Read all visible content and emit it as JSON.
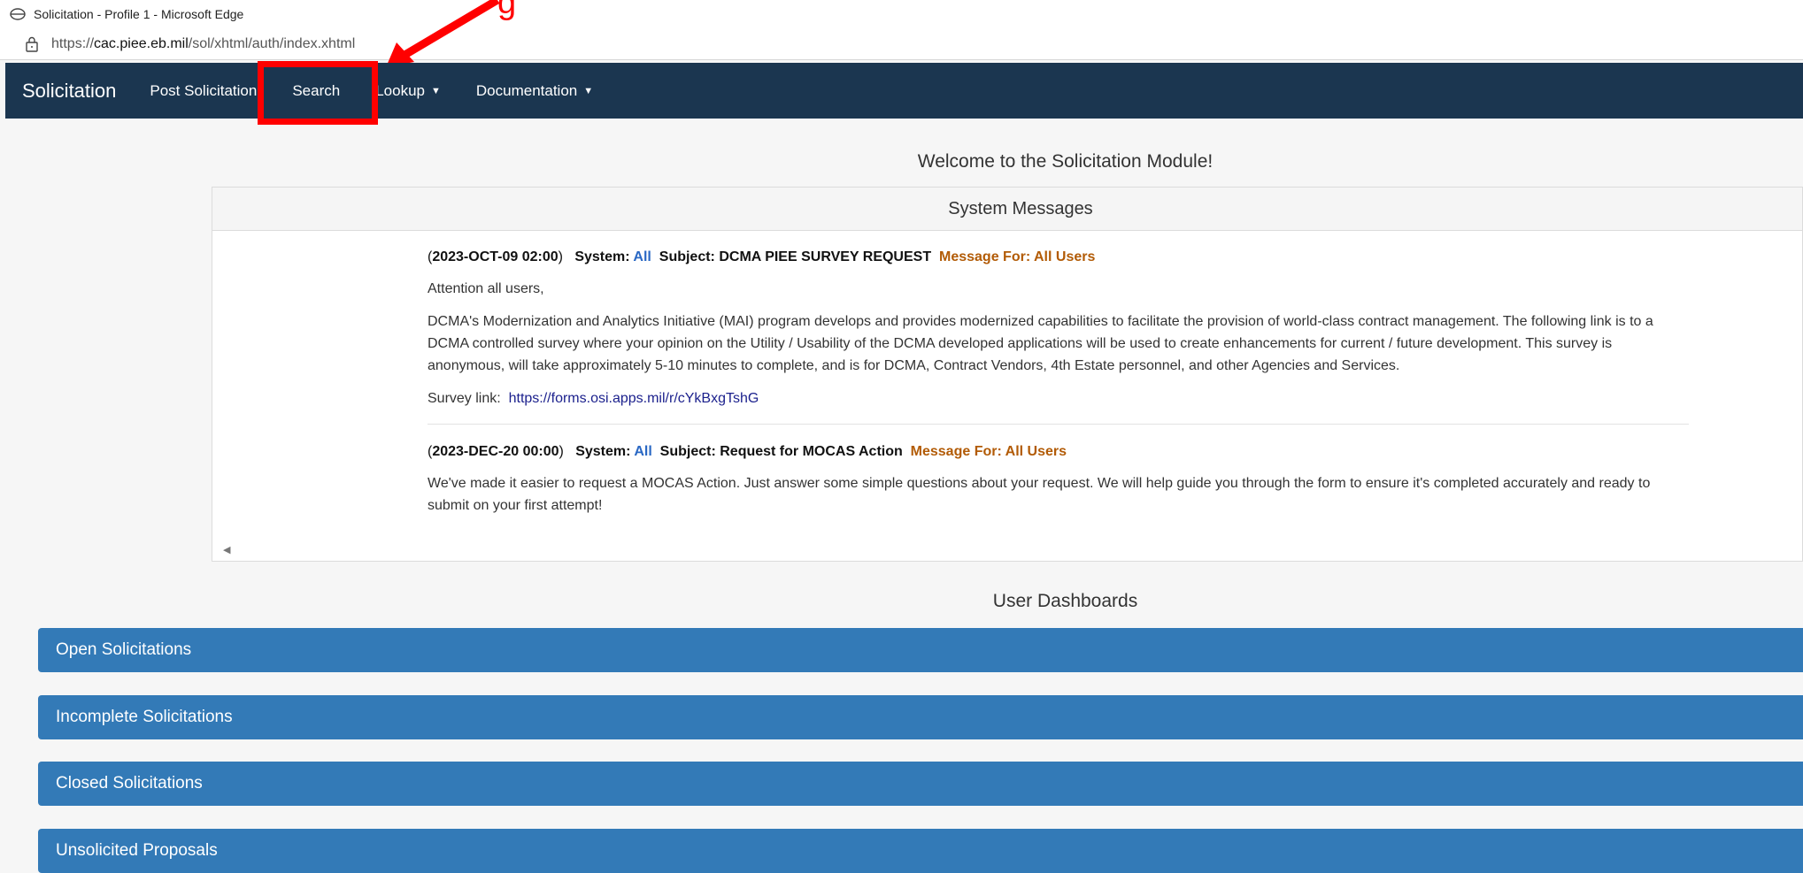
{
  "browser": {
    "window_title": "Solicitation - Profile 1 - Microsoft Edge",
    "url_prefix": "https://",
    "url_host": "cac.piee.eb.mil",
    "url_path": "/sol/xhtml/auth/index.xhtml"
  },
  "navbar": {
    "brand": "Solicitation",
    "items": [
      {
        "label": "Post Solicitation"
      },
      {
        "label": "Search"
      },
      {
        "label": "Lookup"
      },
      {
        "label": "Documentation"
      }
    ]
  },
  "welcome": "Welcome to the Solicitation Module!",
  "system_messages": {
    "header": "System Messages",
    "messages": [
      {
        "date": "2023-OCT-09 02:00",
        "system_label": "System:",
        "system_value": "All",
        "subject_label": "Subject:",
        "subject": "DCMA PIEE SURVEY REQUEST",
        "message_for": "Message For: All Users",
        "paragraphs": [
          "Attention all users,",
          "DCMA's Modernization and Analytics Initiative (MAI) program develops and provides modernized capabilities to facilitate the provision of world-class contract management.  The following link is to a DCMA controlled survey where your opinion on the Utility / Usability of the DCMA developed applications will be used to create enhancements for current / future development. This survey is anonymous, will take approximately 5-10 minutes to complete, and is for DCMA, Contract Vendors, 4th Estate personnel, and other Agencies and Services."
        ],
        "link_label": "Survey link:",
        "link_text": "https://forms.osi.apps.mil/r/cYkBxgTshG"
      },
      {
        "date": "2023-DEC-20 00:00",
        "system_label": "System:",
        "system_value": "All",
        "subject_label": "Subject:",
        "subject": "Request for MOCAS Action",
        "message_for": "Message For: All Users",
        "paragraphs": [
          "We've made it easier to request a MOCAS Action. Just answer some simple questions about your request. We will help guide you through the form to ensure it's completed accurately and ready to submit on your first attempt!"
        ]
      }
    ]
  },
  "dashboards": {
    "title": "User Dashboards",
    "items": [
      {
        "label": "Open Solicitations"
      },
      {
        "label": "Incomplete Solicitations"
      },
      {
        "label": "Closed Solicitations"
      },
      {
        "label": "Unsolicited Proposals"
      }
    ]
  },
  "annotation": {
    "color": "#ff0000",
    "label_fragment": "g"
  },
  "colors": {
    "navbar": "#1b3650",
    "dashboard_bar": "#337ab7",
    "system_value": "#2a68c4",
    "message_for": "#b25b06",
    "link": "#1a1f8c"
  }
}
